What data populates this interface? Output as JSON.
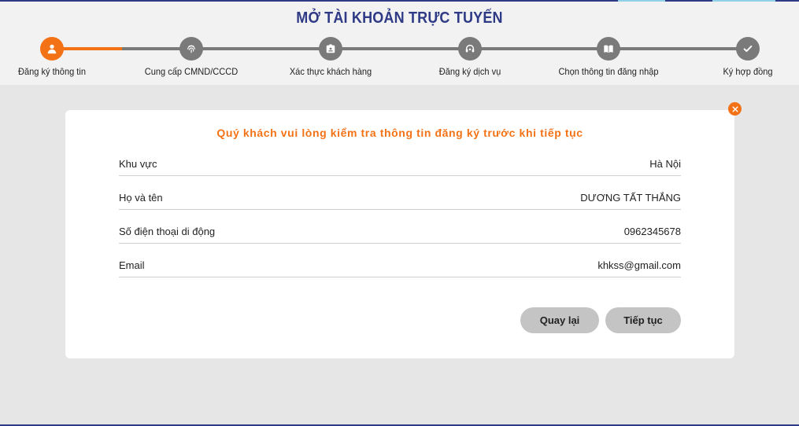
{
  "header": {
    "title": "MỞ TÀI KHOẢN TRỰC TUYẾN"
  },
  "steps": [
    {
      "label": "Đăng ký thông tin",
      "icon": "user-icon",
      "active": true
    },
    {
      "label": "Cung cấp CMND/CCCD",
      "icon": "fingerprint-icon",
      "active": false
    },
    {
      "label": "Xác thực khách hàng",
      "icon": "id-card-icon",
      "active": false
    },
    {
      "label": "Đăng ký dịch vụ",
      "icon": "headset-icon",
      "active": false
    },
    {
      "label": "Chọn thông tin đăng nhập",
      "icon": "book-icon",
      "active": false
    },
    {
      "label": "Ký hợp đồng",
      "icon": "check-icon",
      "active": false
    }
  ],
  "card": {
    "title": "Quý khách vui lòng kiểm tra thông tin đăng ký trước khi tiếp tục",
    "fields": [
      {
        "label": "Khu vực",
        "value": "Hà Nội"
      },
      {
        "label": "Họ và tên",
        "value": "DƯƠNG TẤT THẮNG"
      },
      {
        "label": "Số điện thoại di động",
        "value": "0962345678"
      },
      {
        "label": "Email",
        "value": "khkss@gmail.com"
      }
    ],
    "back_label": "Quay lại",
    "next_label": "Tiếp tục"
  },
  "colors": {
    "accent": "#f47216",
    "brand": "#2e3a86",
    "inactive": "#7a7a7a",
    "button": "#c4c4c4"
  }
}
